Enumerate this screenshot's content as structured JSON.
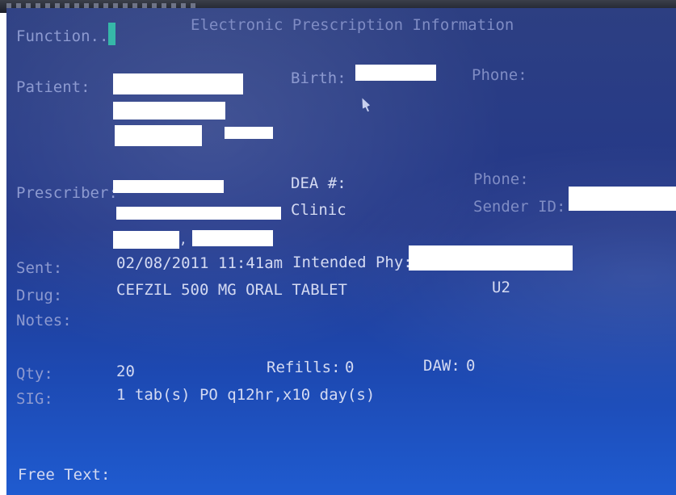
{
  "header": {
    "function_label": "Function...",
    "title": "Electronic Prescription Information"
  },
  "patient": {
    "label": "Patient:",
    "birth_label": "Birth:",
    "phone_label": "Phone:"
  },
  "prescriber": {
    "label": "Prescriber:",
    "dea_label": "DEA #:",
    "phone_label": "Phone:",
    "sender_id_label": "Sender ID:",
    "clinic_text": "Clinic"
  },
  "sent": {
    "label": "Sent:",
    "date": "02/08/2011",
    "time": "11:41am",
    "intended_phy_label": "Intended Phy:"
  },
  "drug": {
    "label": "Drug:",
    "value": "CEFZIL 500 MG ORAL TABLET",
    "code": "U2"
  },
  "notes": {
    "label": "Notes:"
  },
  "qty": {
    "label": "Qty:",
    "value": "20"
  },
  "refills": {
    "label": "Refills:",
    "value": "0"
  },
  "daw": {
    "label": "DAW:",
    "value": "0"
  },
  "sig": {
    "label": "SIG:",
    "value": "1 tab(s) PO q12hr,x10 day(s)"
  },
  "free_text": {
    "label": "Free Text:"
  },
  "colors": {
    "screen_background": "#23388a",
    "text": "#b4bfe7",
    "cursor": "#36b8a8",
    "redaction": "#ffffff"
  }
}
